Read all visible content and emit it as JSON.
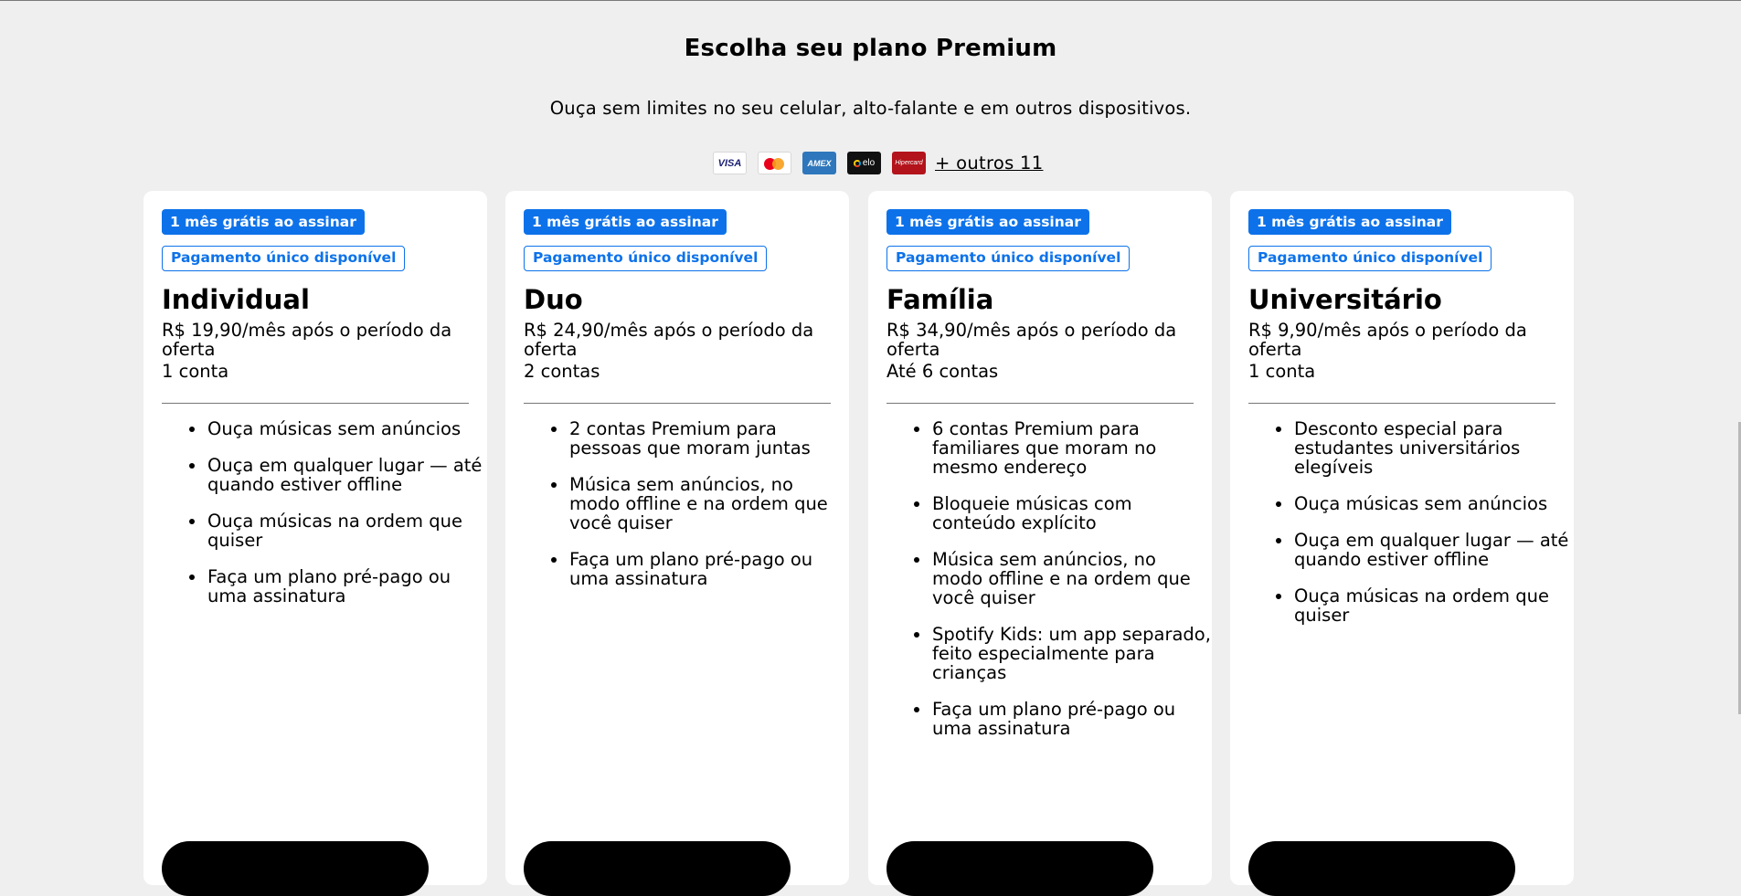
{
  "page": {
    "title": "Escolha seu plano Premium",
    "subtitle": "Ouça sem limites no seu celular, alto-falante e em outros dispositivos."
  },
  "payment_methods": {
    "visa": "VISA",
    "mastercard": "mastercard-icon",
    "amex": "AMEX",
    "elo": "elo",
    "hipercard": "Hipercard",
    "more_link": "+ outros 11"
  },
  "colors": {
    "accent": "#0d72ea",
    "background": "#efefef",
    "card": "#ffffff",
    "button": "#000000"
  },
  "plans": [
    {
      "badge_free": "1 mês grátis ao assinar",
      "badge_once": "Pagamento único disponível",
      "name": "Individual",
      "price": "R$ 19,90/mês após o período da oferta",
      "accounts": "1 conta",
      "features": [
        "Ouça músicas sem anúncios",
        "Ouça em qualquer lugar — até quando estiver offline",
        "Ouça músicas na ordem que quiser",
        "Faça um plano pré-pago ou uma assinatura"
      ]
    },
    {
      "badge_free": "1 mês grátis ao assinar",
      "badge_once": "Pagamento único disponível",
      "name": "Duo",
      "price": "R$ 24,90/mês após o período da oferta",
      "accounts": "2 contas",
      "features": [
        "2 contas Premium para pessoas que moram juntas",
        "Música sem anúncios, no modo offline e na ordem que você quiser",
        "Faça um plano pré-pago ou uma assinatura"
      ]
    },
    {
      "badge_free": "1 mês grátis ao assinar",
      "badge_once": "Pagamento único disponível",
      "name": "Família",
      "price": "R$ 34,90/mês após o período da oferta",
      "accounts": "Até 6 contas",
      "features": [
        "6 contas Premium para familiares que moram no mesmo endereço",
        "Bloqueie músicas com conteúdo explícito",
        "Música sem anúncios, no modo offline e na ordem que você quiser",
        "Spotify Kids: um app separado, feito especialmente para crianças",
        "Faça um plano pré-pago ou uma assinatura"
      ]
    },
    {
      "badge_free": "1 mês grátis ao assinar",
      "badge_once": "Pagamento único disponível",
      "name": "Universitário",
      "price": "R$ 9,90/mês após o período da oferta",
      "accounts": "1 conta",
      "features": [
        "Desconto especial para estudantes universitários elegíveis",
        "Ouça músicas sem anúncios",
        "Ouça em qualquer lugar — até quando estiver offline",
        "Ouça músicas na ordem que quiser"
      ]
    }
  ]
}
